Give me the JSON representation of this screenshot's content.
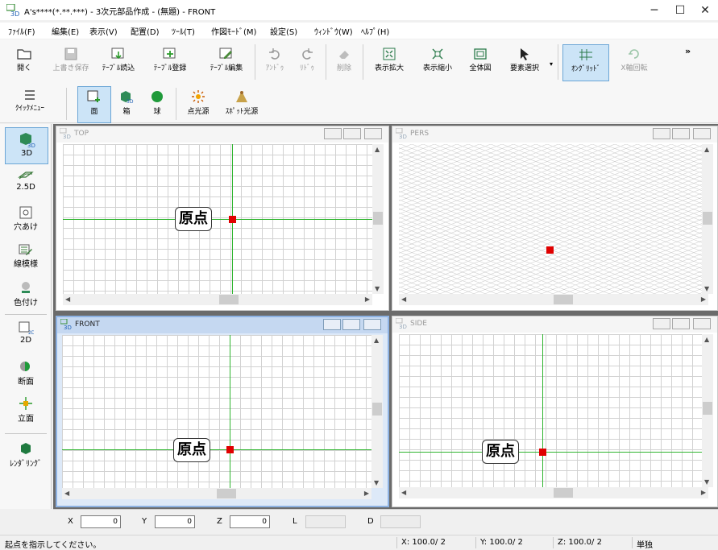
{
  "window": {
    "title": "A's****(*.**.***) - 3次元部品作成 - (無題) - FRONT",
    "minimize": "─",
    "maximize": "☐",
    "close": "✕"
  },
  "menu": [
    "ﾌｧｲﾙ(F)",
    "編集(E)",
    "表示(V)",
    "配置(D)",
    "ﾂｰﾙ(T)",
    "作図ﾓｰﾄﾞ(M)",
    "設定(S)",
    "ｳｨﾝﾄﾞｳ(W)",
    "ﾍﾙﾌﾟ(H)"
  ],
  "toolbar1": {
    "open": "開く",
    "overwrite_save": "上書き保存",
    "table_read": "ﾃｰﾌﾞﾙ読込",
    "table_register": "ﾃｰﾌﾞﾙ登録",
    "table_edit": "ﾃｰﾌﾞﾙ編集",
    "undo": "ｱﾝﾄﾞｩ",
    "redo": "ﾘﾄﾞｩ",
    "delete": "削除",
    "zoom_in": "表示拡大",
    "zoom_out": "表示縮小",
    "full_view": "全体図",
    "element_select": "要素選択",
    "on_grid": "ｵﾝｸﾞﾘｯﾄﾞ",
    "x_rotate": "X軸回転",
    "overflow": "»"
  },
  "toolbar2": {
    "quick_menu": "ｸｲｯｸﾒﾆｭｰ",
    "face": "面",
    "box": "箱",
    "sphere": "球",
    "point_light": "点光源",
    "spot_light": "ｽﾎﾟｯﾄ光源"
  },
  "palette": {
    "p3d": "3D",
    "p25d": "2.5D",
    "hole": "穴あけ",
    "line_pattern": "線模様",
    "coloring": "色付け",
    "p2d": "2D",
    "section": "断面",
    "elevation": "立面",
    "rendering": "ﾚﾝﾀﾞﾘﾝｸﾞ"
  },
  "views": {
    "top": "TOP",
    "pers": "PERS",
    "front": "FRONT",
    "side": "SIDE",
    "origin_label": "原点"
  },
  "coords": {
    "x_label": "X",
    "x_value": "0",
    "y_label": "Y",
    "y_value": "0",
    "z_label": "Z",
    "z_value": "0",
    "l_label": "L",
    "d_label": "D"
  },
  "status": {
    "message": "起点を指示してください。",
    "x": "X: 100.0/ 2",
    "y": "Y: 100.0/ 2",
    "z": "Z: 100.0/ 2",
    "mode": "単独"
  },
  "colors": {
    "axis": "#2fb52f",
    "origin": "#e00000",
    "active_border": "#8db2e3"
  }
}
